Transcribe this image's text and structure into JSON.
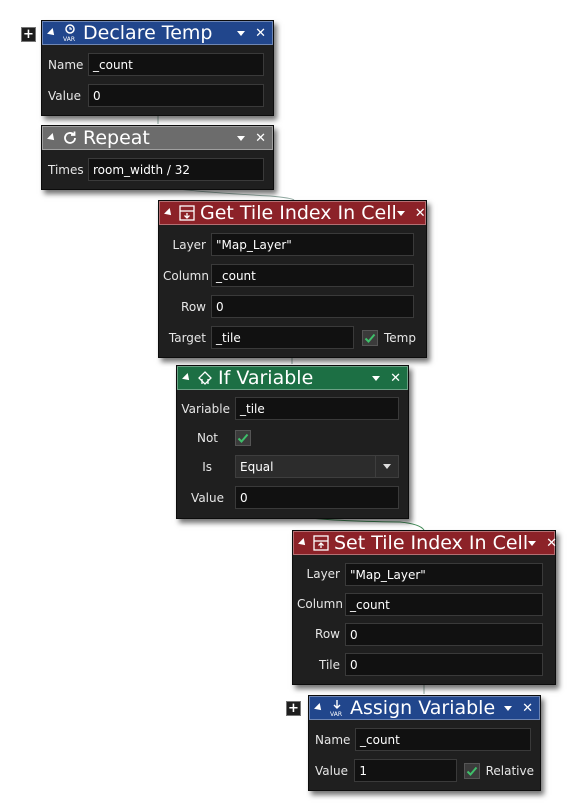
{
  "connectors_color": "#8fa8a0",
  "declare_temp": {
    "title": "Declare Temp",
    "icon": "var-declare-icon",
    "fields": [
      {
        "label": "Name",
        "value": "_count"
      },
      {
        "label": "Value",
        "value": "0"
      }
    ]
  },
  "repeat": {
    "title": "Repeat",
    "icon": "repeat-icon",
    "fields": [
      {
        "label": "Times",
        "value": "room_width / 32"
      }
    ]
  },
  "get_tile": {
    "title": "Get Tile Index In Cell",
    "icon": "get-tile-icon",
    "fields": [
      {
        "label": "Layer",
        "value": "\"Map_Layer\""
      },
      {
        "label": "Column",
        "value": "_count"
      },
      {
        "label": "Row",
        "value": "0"
      },
      {
        "label": "Target",
        "value": "_tile"
      }
    ],
    "temp_label": "Temp",
    "temp_checked": true
  },
  "if_variable": {
    "title": "If Variable",
    "icon": "if-variable-icon",
    "fields": [
      {
        "label": "Variable",
        "value": "_tile"
      },
      {
        "label": "Not",
        "value": ""
      },
      {
        "label": "Is",
        "value": "Equal"
      },
      {
        "label": "Value",
        "value": "0"
      }
    ],
    "not_checked": true
  },
  "set_tile": {
    "title": "Set Tile Index In Cell",
    "icon": "set-tile-icon",
    "fields": [
      {
        "label": "Layer",
        "value": "\"Map_Layer\""
      },
      {
        "label": "Column",
        "value": "_count"
      },
      {
        "label": "Row",
        "value": "0"
      },
      {
        "label": "Tile",
        "value": "0"
      }
    ]
  },
  "assign_variable": {
    "title": "Assign Variable",
    "icon": "var-assign-icon",
    "fields": [
      {
        "label": "Name",
        "value": "_count"
      },
      {
        "label": "Value",
        "value": "1"
      }
    ],
    "relative_label": "Relative",
    "relative_checked": true
  },
  "expand_button": "+"
}
